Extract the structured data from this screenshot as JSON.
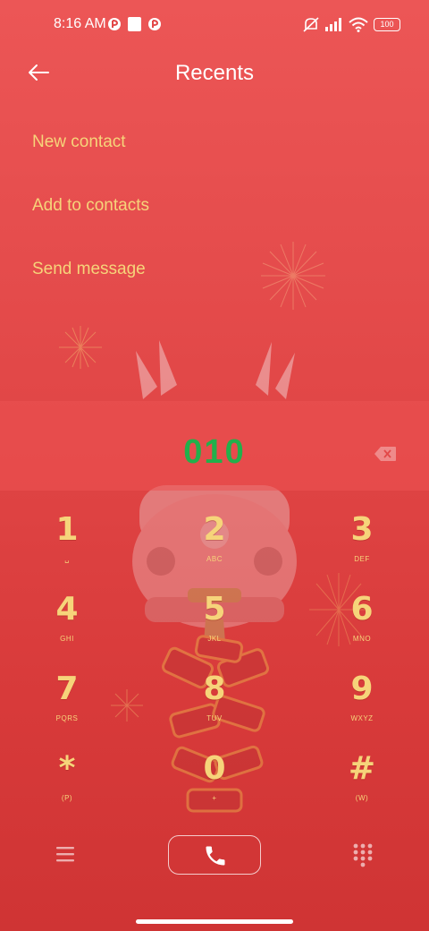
{
  "status_bar": {
    "time": "8:16 AM",
    "battery": "100",
    "icons": [
      "notification-icon",
      "square-icon",
      "notification-icon",
      "mute-icon",
      "signal-icon",
      "wifi-icon",
      "battery-icon"
    ]
  },
  "header": {
    "title": "Recents",
    "back_icon": "arrow-left-icon"
  },
  "menu": {
    "items": [
      {
        "label": "New contact"
      },
      {
        "label": "Add to contacts"
      },
      {
        "label": "Send message"
      }
    ]
  },
  "display": {
    "number": "010",
    "delete_icon": "backspace-icon"
  },
  "keypad": {
    "keys": [
      {
        "digit": "1",
        "sub": "␣"
      },
      {
        "digit": "2",
        "sub": "ABC"
      },
      {
        "digit": "3",
        "sub": "DEF"
      },
      {
        "digit": "4",
        "sub": "GHI"
      },
      {
        "digit": "5",
        "sub": "JKL"
      },
      {
        "digit": "6",
        "sub": "MNO"
      },
      {
        "digit": "7",
        "sub": "PQRS"
      },
      {
        "digit": "8",
        "sub": "TUV"
      },
      {
        "digit": "9",
        "sub": "WXYZ"
      },
      {
        "digit": "*",
        "sub": "(P)"
      },
      {
        "digit": "0",
        "sub": "+"
      },
      {
        "digit": "#",
        "sub": "(W)"
      }
    ]
  },
  "bottom_bar": {
    "menu_icon": "hamburger-menu-icon",
    "call_icon": "phone-icon",
    "dialpad_icon": "dialpad-icon"
  },
  "colors": {
    "background": "#e24848",
    "accent_gold": "#f6d47a",
    "number_green": "#22b04b",
    "white": "#ffffff"
  }
}
